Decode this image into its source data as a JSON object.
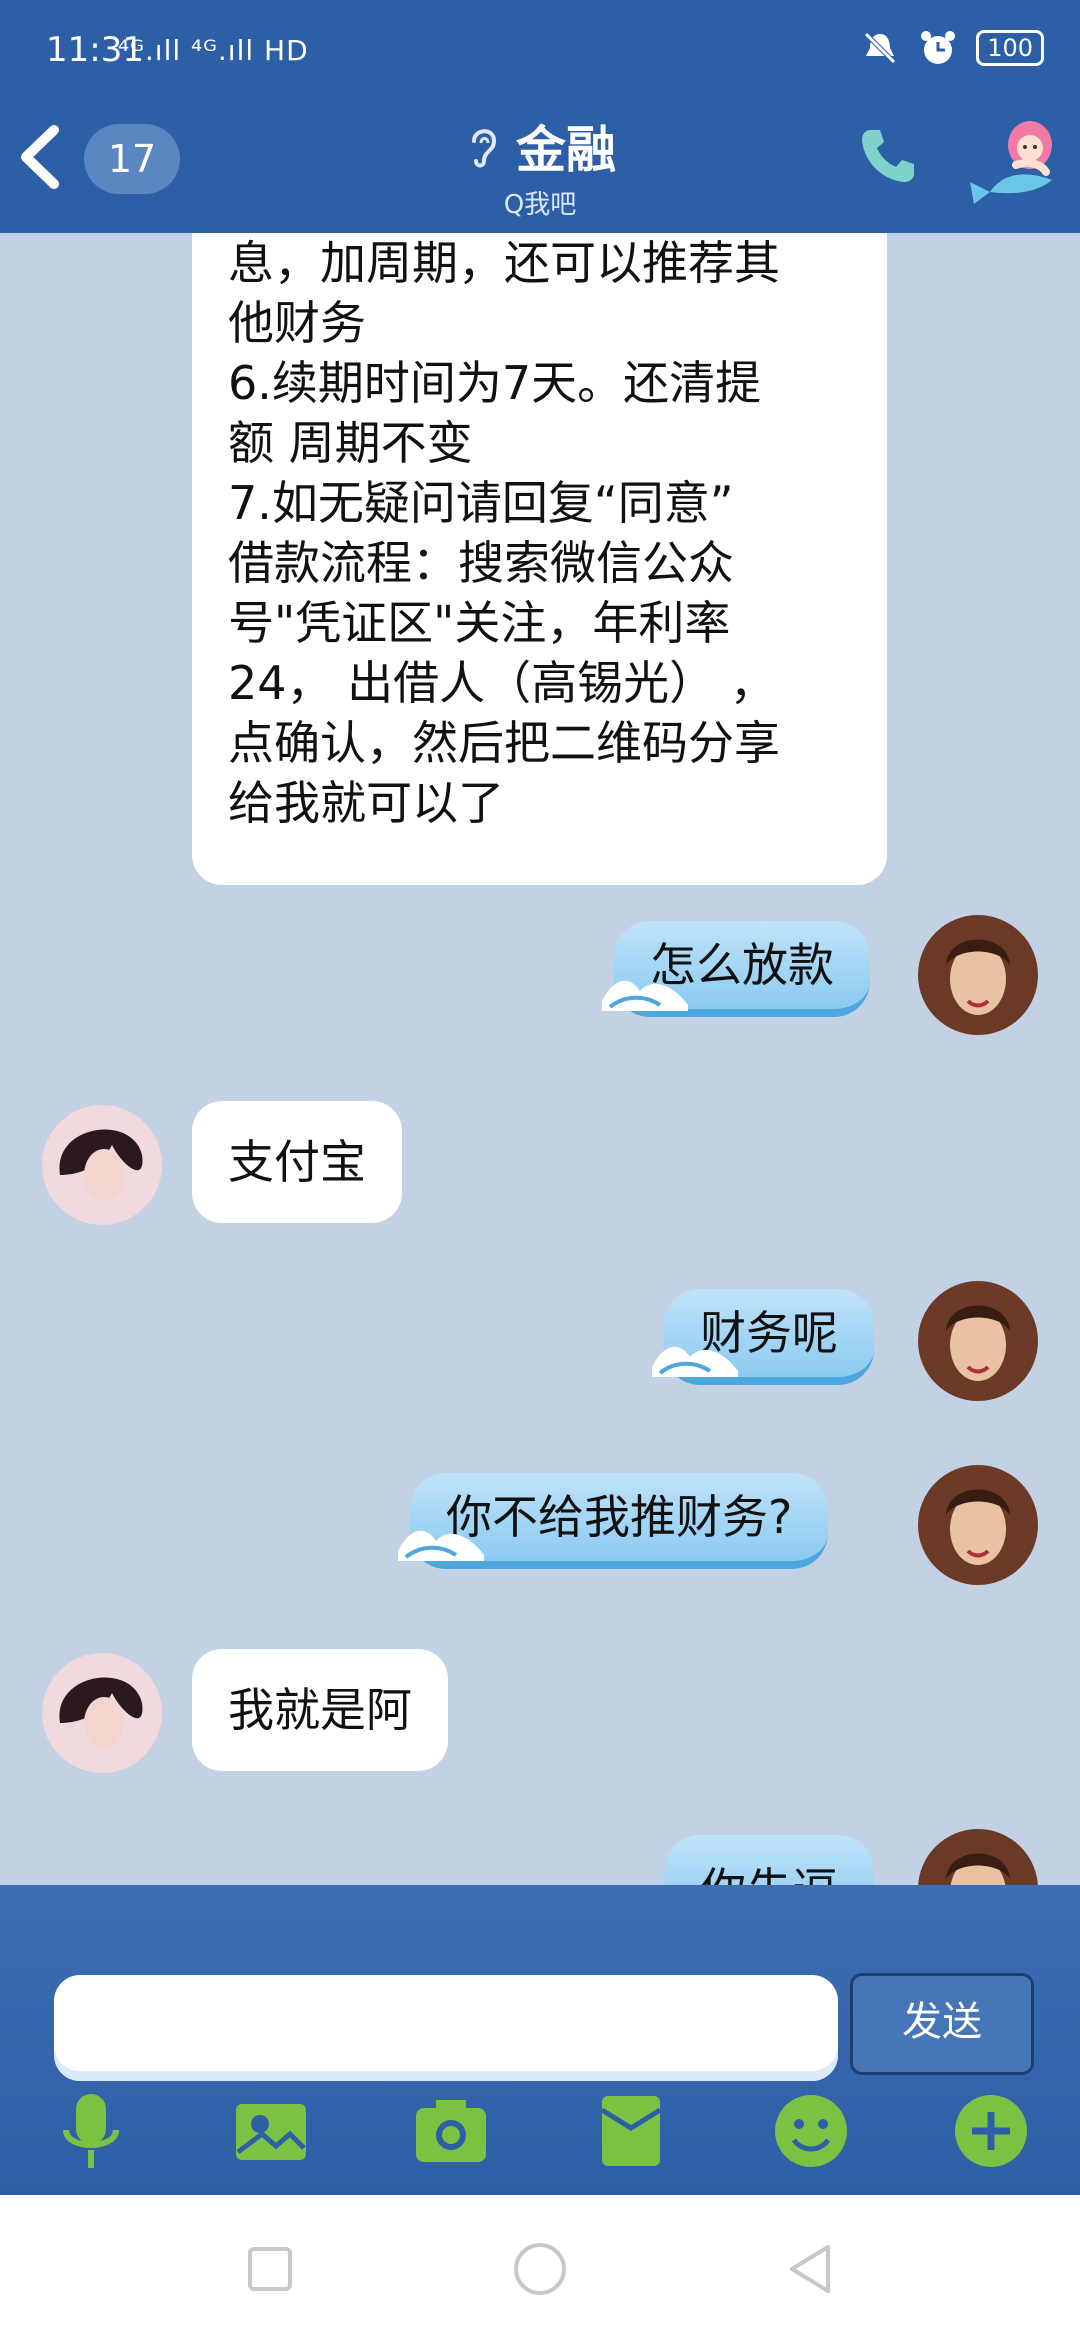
{
  "status_bar": {
    "time": "11:31",
    "network": "⁴ᴳ.ıll ⁴ᴳ.ıll HD",
    "battery": "100"
  },
  "header": {
    "unread_count": "17",
    "title": "金融",
    "subtitle": "Q我吧"
  },
  "messages": [
    {
      "side": "left",
      "lines": [
        "息，加周期，还可以推荐其",
        "他财务",
        "6.续期时间为7天。还清提",
        "额 周期不变",
        "7.如无疑问请回复“同意”",
        "借款流程：搜索微信公众",
        "号\"凭证区\"关注，年利率",
        "24， 出借人（高锡光） ，",
        "点确认，然后把二维码分享",
        "给我就可以了"
      ]
    },
    {
      "side": "right",
      "text": "怎么放款"
    },
    {
      "side": "left",
      "text": "支付宝"
    },
    {
      "side": "right",
      "text": "财务呢"
    },
    {
      "side": "right",
      "text": "你不给我推财务?"
    },
    {
      "side": "left",
      "text": "我就是阿"
    },
    {
      "side": "right",
      "text": "你先逗"
    }
  ],
  "input": {
    "send_label": "发送"
  },
  "colors": {
    "header_bg": "#2d5fa6",
    "chat_bg": "#c2d1e3",
    "toolbar_icon": "#7cc242"
  },
  "icons": [
    "back-icon",
    "ear-icon",
    "phone-icon",
    "mermaid-icon",
    "microphone-icon",
    "image-icon",
    "camera-icon",
    "red-packet-icon",
    "emoji-icon",
    "plus-icon",
    "recent-apps-icon",
    "home-icon",
    "back-nav-icon"
  ]
}
